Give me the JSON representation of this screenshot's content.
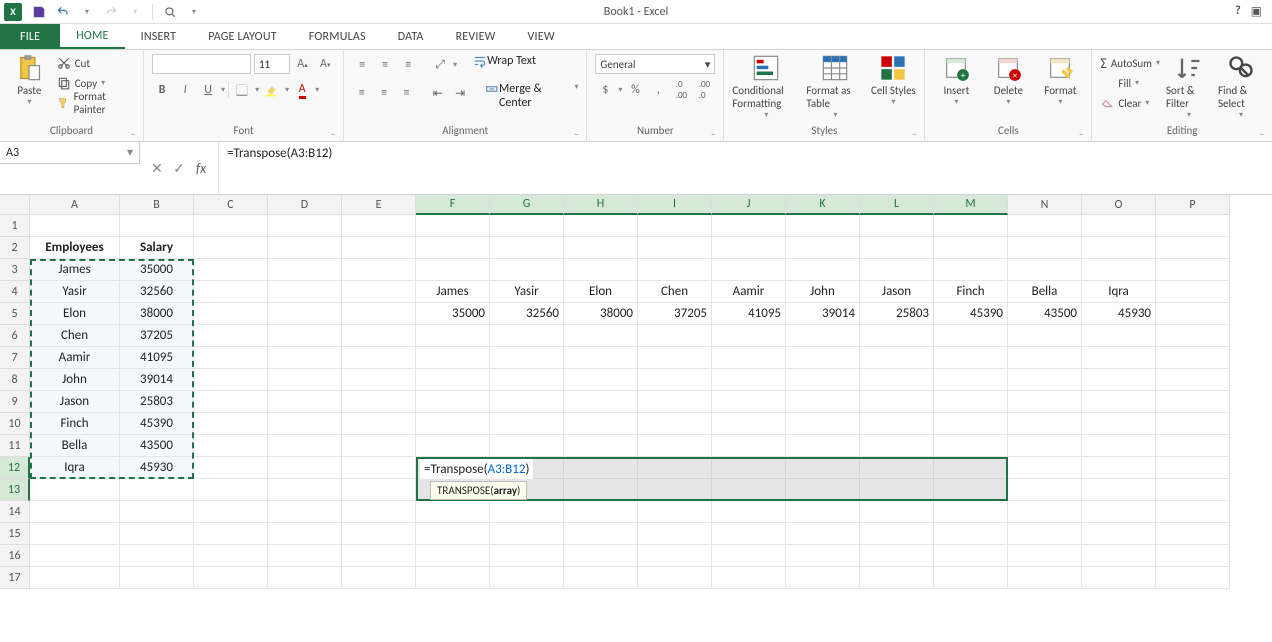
{
  "title": "Book1 - Excel",
  "tabs": {
    "file": "FILE",
    "home": "HOME",
    "insert": "INSERT",
    "pagelayout": "PAGE LAYOUT",
    "formulas": "FORMULAS",
    "data": "DATA",
    "review": "REVIEW",
    "view": "VIEW"
  },
  "clipboard": {
    "paste": "Paste",
    "cut": "Cut",
    "copy": "Copy",
    "fmt": "Format Painter",
    "label": "Clipboard"
  },
  "font": {
    "size": "11",
    "bold": "B",
    "italic": "I",
    "underline": "U",
    "label": "Font"
  },
  "alignment": {
    "wrap": "Wrap Text",
    "merge": "Merge & Center",
    "label": "Alignment"
  },
  "number": {
    "general": "General",
    "label": "Number"
  },
  "styles": {
    "cond": "Conditional Formatting",
    "fat": "Format as Table",
    "cs": "Cell Styles",
    "label": "Styles"
  },
  "cells": {
    "insert": "Insert",
    "delete": "Delete",
    "format": "Format",
    "label": "Cells"
  },
  "editing": {
    "autosum": "AutoSum",
    "fill": "Fill",
    "clear": "Clear",
    "sort": "Sort & Filter",
    "find": "Find & Select",
    "label": "Editing"
  },
  "namebox": "A3",
  "formula": "=Transpose(A3:B12)",
  "columns": [
    "A",
    "B",
    "C",
    "D",
    "E",
    "F",
    "G",
    "H",
    "I",
    "J",
    "K",
    "L",
    "M",
    "N",
    "O",
    "P"
  ],
  "rownums": [
    "1",
    "2",
    "3",
    "4",
    "5",
    "6",
    "7",
    "8",
    "9",
    "10",
    "11",
    "12",
    "13",
    "14",
    "15",
    "16",
    "17"
  ],
  "headers": {
    "emp": "Employees",
    "sal": "Salary"
  },
  "employees": [
    "James",
    "Yasir",
    "Elon",
    "Chen",
    "Aamir",
    "John",
    "Jason",
    "Finch",
    "Bella",
    "Iqra"
  ],
  "salaries": [
    "35000",
    "32560",
    "38000",
    "37205",
    "41095",
    "39014",
    "25803",
    "45390",
    "43500",
    "45930"
  ],
  "editcell_pre": "=Transpose(",
  "editcell_ref": "A3:B12",
  "editcell_post": ")",
  "tooltip_fn": "TRANSPOSE(",
  "tooltip_arg": "array",
  "tooltip_end": ")",
  "chart_data": {
    "type": "table",
    "title": "Employee Salary (source range A2:B12 and transposed result in F4:O5)",
    "columns": [
      "Employees",
      "Salary"
    ],
    "rows": [
      [
        "James",
        35000
      ],
      [
        "Yasir",
        32560
      ],
      [
        "Elon",
        38000
      ],
      [
        "Chen",
        37205
      ],
      [
        "Aamir",
        41095
      ],
      [
        "John",
        39014
      ],
      [
        "Jason",
        25803
      ],
      [
        "Finch",
        45390
      ],
      [
        "Bella",
        43500
      ],
      [
        "Iqra",
        45930
      ]
    ]
  }
}
